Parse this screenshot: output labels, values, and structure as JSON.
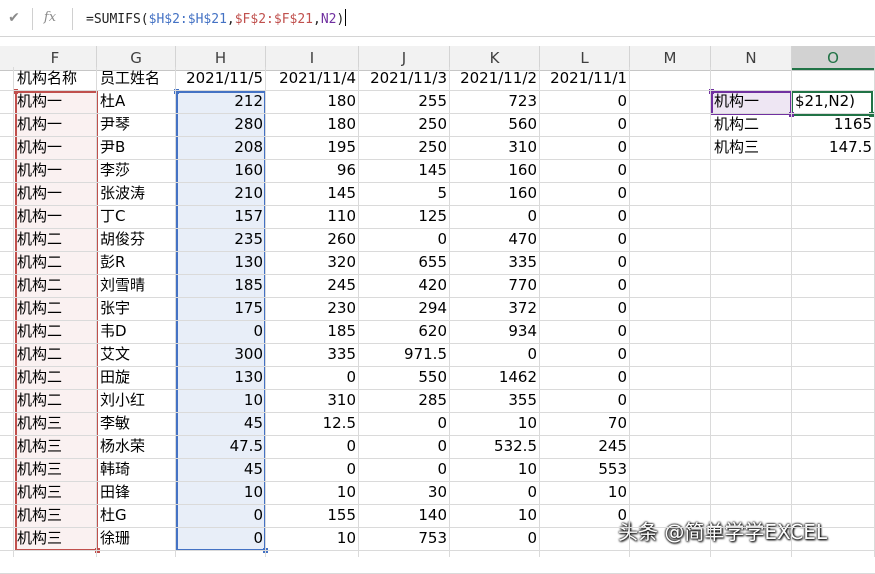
{
  "formula_bar": {
    "cancel_icon": "check-icon",
    "fx_label": "fx",
    "formula_parts": [
      {
        "text": "=SUMIFS(",
        "color": "plain"
      },
      {
        "text": "$H$2:$H$21",
        "color": "blue"
      },
      {
        "text": ",",
        "color": "plain"
      },
      {
        "text": "$F$2:$F$21",
        "color": "red"
      },
      {
        "text": ",",
        "color": "plain"
      },
      {
        "text": "N2",
        "color": "purple"
      },
      {
        "text": ")",
        "color": "plain"
      }
    ]
  },
  "columns": [
    "F",
    "G",
    "H",
    "I",
    "J",
    "K",
    "L",
    "M",
    "N",
    "O"
  ],
  "selected_column": "O",
  "headers": {
    "F": "机构名称",
    "G": "员工姓名",
    "H": "2021/11/5",
    "I": "2021/11/4",
    "J": "2021/11/3",
    "K": "2021/11/2",
    "L": "2021/11/1"
  },
  "rows": [
    [
      "机构一",
      "杜A",
      "212",
      "180",
      "255",
      "723",
      "0"
    ],
    [
      "机构一",
      "尹琴",
      "280",
      "180",
      "250",
      "560",
      "0"
    ],
    [
      "机构一",
      "尹B",
      "208",
      "195",
      "250",
      "310",
      "0"
    ],
    [
      "机构一",
      "李莎",
      "160",
      "96",
      "145",
      "160",
      "0"
    ],
    [
      "机构一",
      "张波涛",
      "210",
      "145",
      "5",
      "160",
      "0"
    ],
    [
      "机构一",
      "丁C",
      "157",
      "110",
      "125",
      "0",
      "0"
    ],
    [
      "机构二",
      "胡俊芬",
      "235",
      "260",
      "0",
      "470",
      "0"
    ],
    [
      "机构二",
      "彭R",
      "130",
      "320",
      "655",
      "335",
      "0"
    ],
    [
      "机构二",
      "刘雪晴",
      "185",
      "245",
      "420",
      "770",
      "0"
    ],
    [
      "机构二",
      "张宇",
      "175",
      "230",
      "294",
      "372",
      "0"
    ],
    [
      "机构二",
      "韦D",
      "0",
      "185",
      "620",
      "934",
      "0"
    ],
    [
      "机构二",
      "艾文",
      "300",
      "335",
      "971.5",
      "0",
      "0"
    ],
    [
      "机构二",
      "田旋",
      "130",
      "0",
      "550",
      "1462",
      "0"
    ],
    [
      "机构二",
      "刘小红",
      "10",
      "310",
      "285",
      "355",
      "0"
    ],
    [
      "机构三",
      "李敏",
      "45",
      "12.5",
      "0",
      "10",
      "70"
    ],
    [
      "机构三",
      "杨水荣",
      "47.5",
      "0",
      "0",
      "532.5",
      "245"
    ],
    [
      "机构三",
      "韩琦",
      "45",
      "0",
      "0",
      "10",
      "553"
    ],
    [
      "机构三",
      "田锋",
      "10",
      "10",
      "30",
      "0",
      "10"
    ],
    [
      "机构三",
      "杜G",
      "0",
      "155",
      "140",
      "10",
      "0"
    ],
    [
      "机构三",
      "徐珊",
      "0",
      "10",
      "753",
      "0",
      ""
    ]
  ],
  "summary": [
    {
      "name": "机构一",
      "value": "$21,N2)"
    },
    {
      "name": "机构二",
      "value": "1165"
    },
    {
      "name": "机构三",
      "value": "147.5"
    }
  ],
  "watermark": "头条 @简单学学EXCEL"
}
